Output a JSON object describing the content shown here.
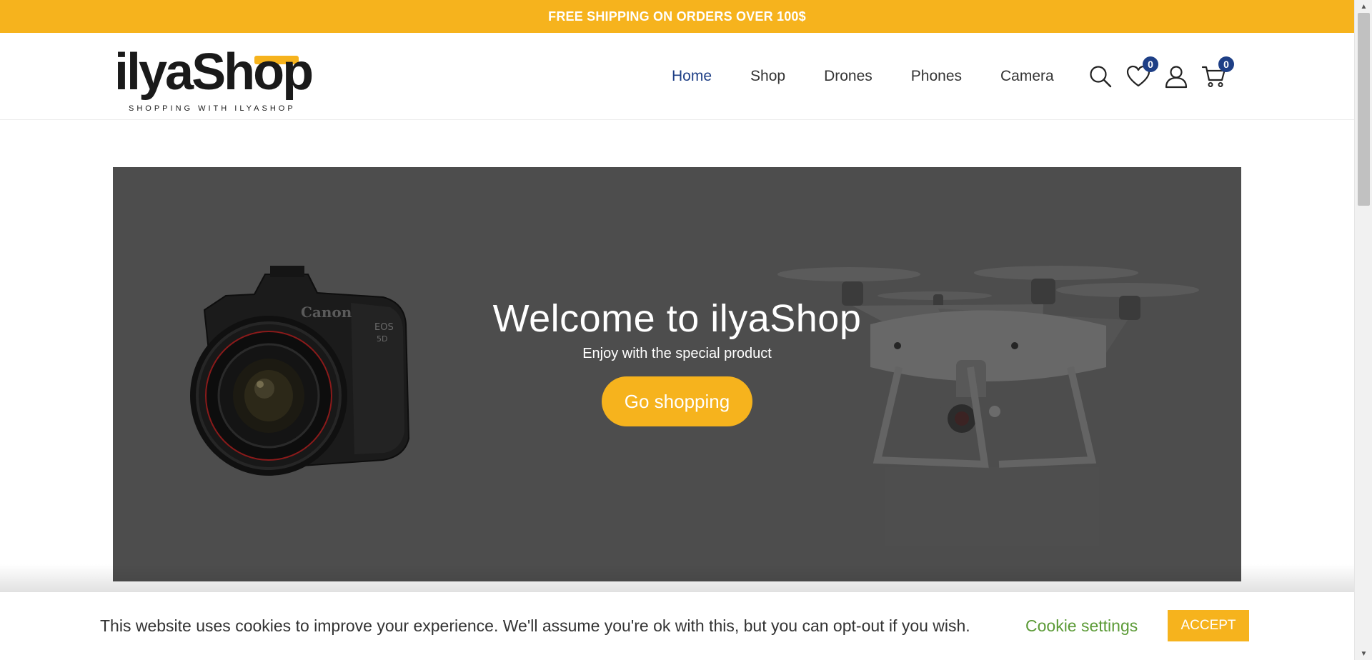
{
  "topbar": {
    "promo_text": "FREE SHIPPING ON ORDERS OVER 100$"
  },
  "header": {
    "logo": {
      "name": "ilyaShop",
      "tagline": "SHOPPING WITH ILYASHOP"
    },
    "nav": [
      {
        "label": "Home",
        "active": true
      },
      {
        "label": "Shop",
        "active": false
      },
      {
        "label": "Drones",
        "active": false
      },
      {
        "label": "Phones",
        "active": false
      },
      {
        "label": "Camera",
        "active": false
      }
    ],
    "icons": {
      "search": "search-icon",
      "wishlist": "heart-icon",
      "wishlist_count": "0",
      "account": "user-icon",
      "cart": "cart-icon",
      "cart_count": "0"
    }
  },
  "hero": {
    "title": "Welcome to ilyaShop",
    "subtitle": "Enjoy with the special product",
    "button_label": "Go shopping",
    "camera_brand": "Canon"
  },
  "cookie": {
    "message": "This website uses cookies to improve your experience. We'll assume you're ok with this, but you can opt-out if you wish.",
    "settings_label": "Cookie settings",
    "accept_label": "ACCEPT"
  },
  "colors": {
    "accent": "#f6b31d",
    "nav_active": "#1e3f86",
    "hero_bg": "#4d4d4d",
    "cookie_link": "#5b9a36"
  }
}
